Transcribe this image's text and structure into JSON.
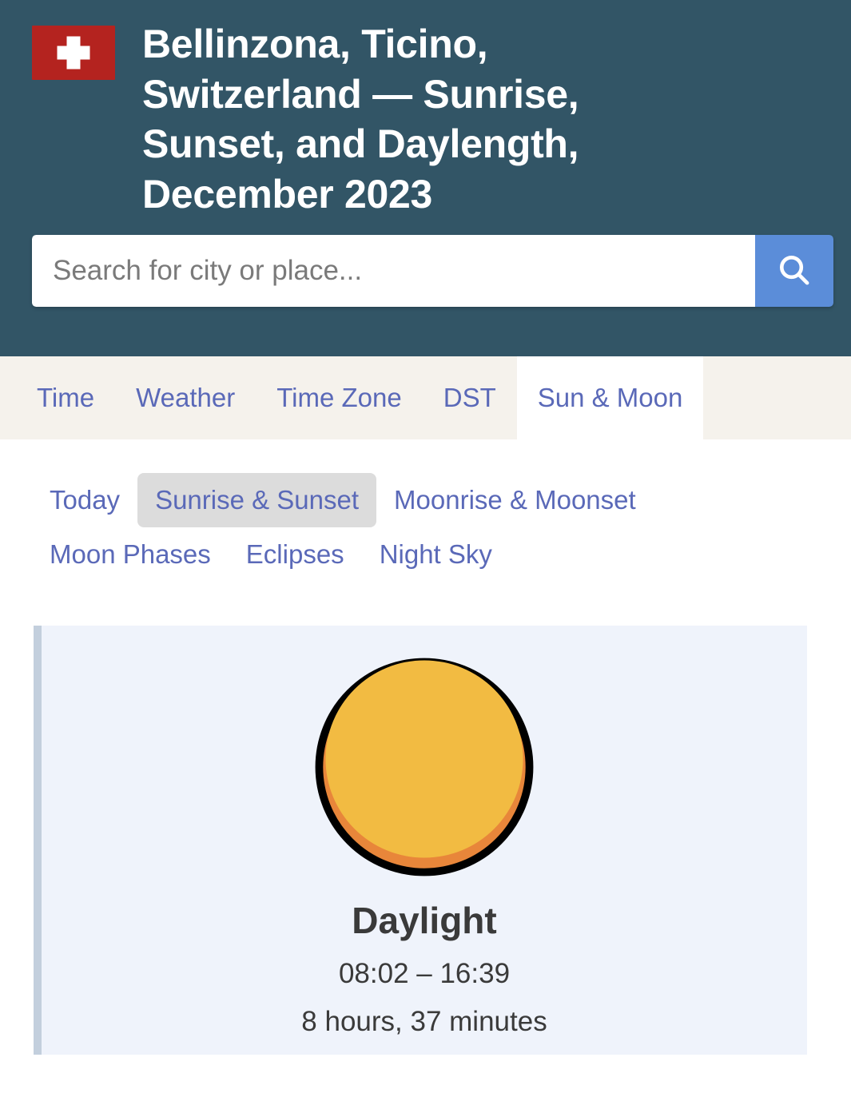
{
  "header": {
    "flag": {
      "country": "Switzerland",
      "background_color": "#b4231f",
      "cross_color": "#ffffff"
    },
    "title": "Bellinzona, Ticino, Switzerland — Sunrise, Sunset, and Daylength, December 2023",
    "background_color": "#325566"
  },
  "search": {
    "placeholder": "Search for city or place...",
    "value": "",
    "button_icon": "search-icon",
    "button_color": "#5b8dd9"
  },
  "tabs": {
    "items": [
      {
        "label": "Time",
        "active": false
      },
      {
        "label": "Weather",
        "active": false
      },
      {
        "label": "Time Zone",
        "active": false
      },
      {
        "label": "DST",
        "active": false
      },
      {
        "label": "Sun & Moon",
        "active": true
      }
    ],
    "bar_color": "#f5f2ec",
    "link_color": "#5a69b8",
    "active_background": "#ffffff"
  },
  "subnav": {
    "items": [
      {
        "label": "Today",
        "active": false
      },
      {
        "label": "Sunrise & Sunset",
        "active": true
      },
      {
        "label": "Moonrise & Moonset",
        "active": false
      },
      {
        "label": "Moon Phases",
        "active": false
      },
      {
        "label": "Eclipses",
        "active": false
      },
      {
        "label": "Night Sky",
        "active": false
      }
    ],
    "active_background": "#dcdcdc",
    "link_color": "#5a69b8"
  },
  "daylight_card": {
    "icon": "sun-icon",
    "title": "Daylight",
    "range": "08:02 – 16:39",
    "sunrise": "08:02",
    "sunset": "16:39",
    "length": "8 hours, 37 minutes",
    "background_color": "#eff3fb",
    "accent_color": "#c3cfdd",
    "sun_fill": "#f2bb42",
    "sun_shadow": "#e8863a",
    "sun_outline": "#000000"
  }
}
